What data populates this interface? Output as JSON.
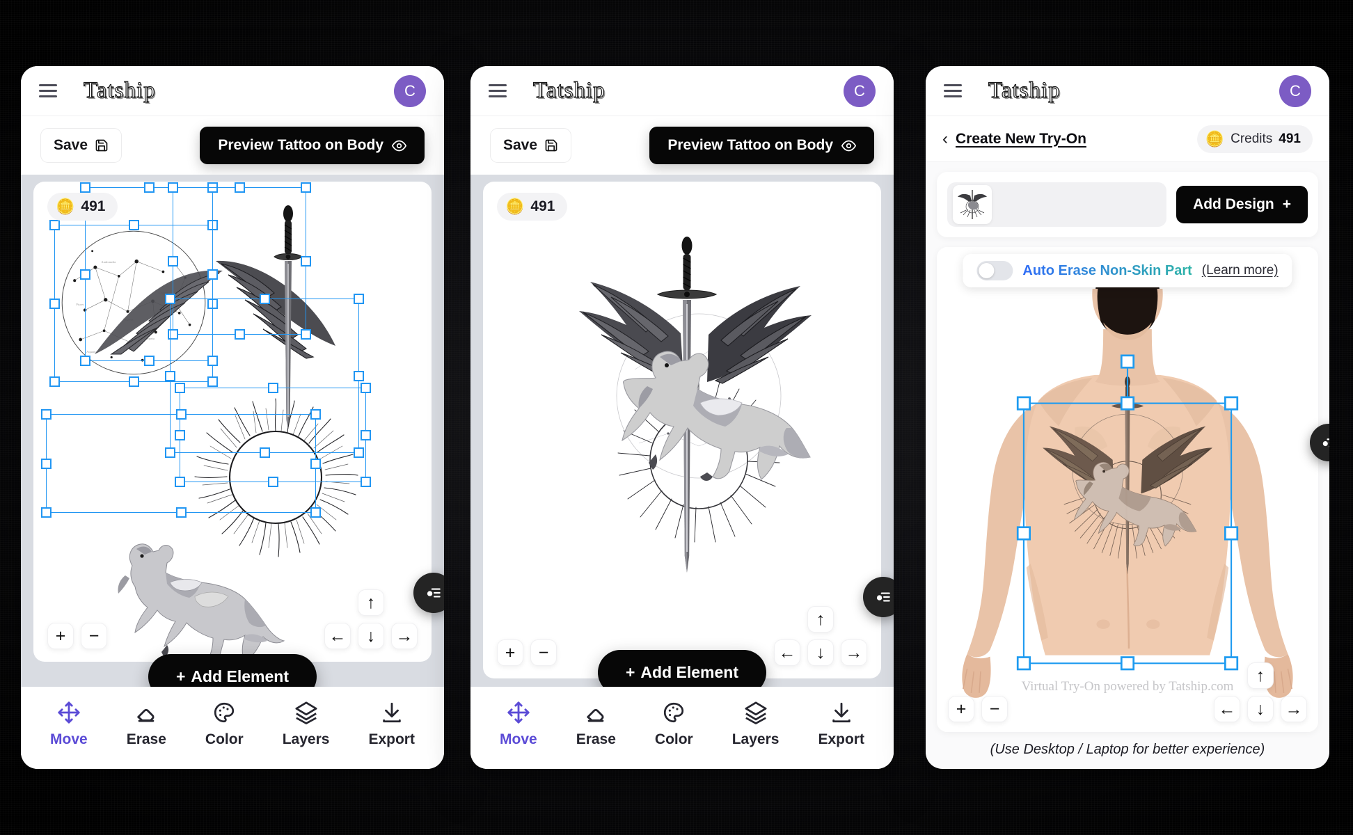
{
  "app": {
    "brand": "Tatship",
    "avatar_initial": "C",
    "menu_icon": "hamburger-icon",
    "avatar_color": "#7c5cc4"
  },
  "editor": {
    "save_label": "Save",
    "save_icon": "floppy-disk-icon",
    "preview_label": "Preview Tattoo on Body",
    "preview_icon": "eye-icon",
    "credits_value": "491",
    "coin_icon": "coins-emoji",
    "add_element_label": "Add Element",
    "add_element_icon": "plus-icon",
    "zoom_in": "+",
    "zoom_out": "−",
    "arrow_up": "↑",
    "arrow_down": "↓",
    "arrow_left": "←",
    "arrow_right": "→",
    "layers_fab_icon": "layers-slider-icon"
  },
  "tools": [
    {
      "label": "Move",
      "icon": "move-icon",
      "active": true
    },
    {
      "label": "Erase",
      "icon": "eraser-icon",
      "active": false
    },
    {
      "label": "Color",
      "icon": "palette-icon",
      "active": false
    },
    {
      "label": "Layers",
      "icon": "layers-icon",
      "active": false
    },
    {
      "label": "Export",
      "icon": "download-icon",
      "active": false
    }
  ],
  "tryon": {
    "back_icon": "chevron-left-icon",
    "title": "Create New Try-On",
    "credits_label": "Credits",
    "credits_value": "491",
    "coin_icon": "coins-emoji",
    "add_design_label": "Add Design",
    "add_design_icon": "plus-icon",
    "design_thumb_alt": "pegasus-sword-tattoo-thumbnail",
    "auto_erase_label": "Auto Erase Non-Skin Part",
    "learn_more_label": "(Learn more)",
    "toggle_state": "off",
    "watermark": "Virtual Try-On powered by Tatship.com",
    "footer_note": "(Use Desktop / Laptop for better experience)",
    "accent_gradient_from": "#2f6df6",
    "accent_gradient_to": "#2fb4a8"
  },
  "canvas_elements": [
    {
      "name": "constellation-circle"
    },
    {
      "name": "left-wing"
    },
    {
      "name": "right-wing"
    },
    {
      "name": "sword"
    },
    {
      "name": "sunburst"
    },
    {
      "name": "pegasus-horse"
    }
  ]
}
